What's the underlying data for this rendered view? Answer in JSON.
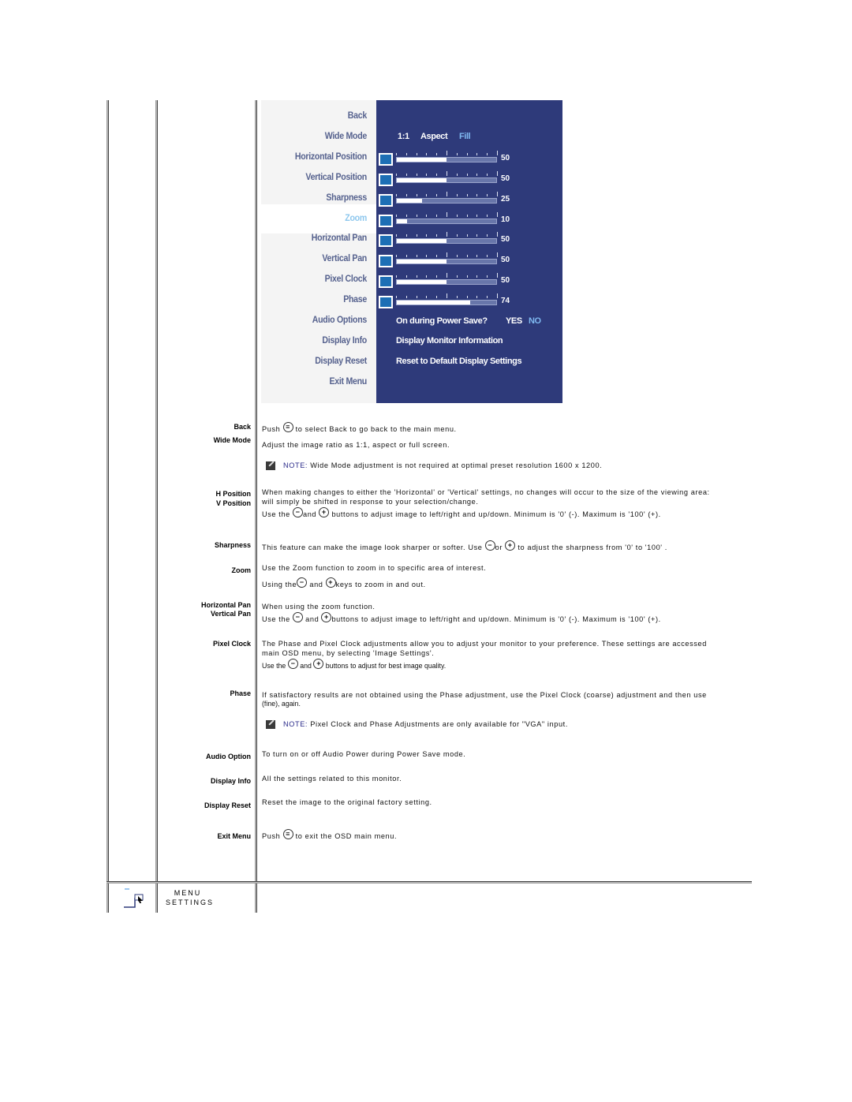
{
  "osd": {
    "menu_items": [
      {
        "label": "Back"
      },
      {
        "label": "Wide Mode"
      },
      {
        "label": "Horizontal Position"
      },
      {
        "label": "Vertical Position"
      },
      {
        "label": "Sharpness"
      },
      {
        "label": "Zoom",
        "active": true
      },
      {
        "label": "Horizontal Pan"
      },
      {
        "label": "Vertical Pan"
      },
      {
        "label": "Pixel Clock"
      },
      {
        "label": "Phase"
      },
      {
        "label": "Audio Options"
      },
      {
        "label": "Display Info"
      },
      {
        "label": "Display Reset"
      },
      {
        "label": "Exit Menu"
      }
    ],
    "wide_mode_options": [
      "1:1",
      "Aspect",
      "Fill"
    ],
    "wide_mode_selected": "Fill",
    "sliders": [
      {
        "name": "Horizontal Position",
        "icon": "horizontal-position-icon",
        "value": 50
      },
      {
        "name": "Vertical Position",
        "icon": "vertical-position-icon",
        "value": 50
      },
      {
        "name": "Sharpness",
        "icon": "sharpness-icon",
        "value": 25
      },
      {
        "name": "Zoom",
        "icon": "zoom-icon",
        "value": 10
      },
      {
        "name": "Horizontal Pan",
        "icon": "horizontal-pan-icon",
        "value": 50
      },
      {
        "name": "Vertical Pan",
        "icon": "vertical-pan-icon",
        "value": 50
      },
      {
        "name": "Pixel Clock",
        "icon": "pixel-clock-icon",
        "value": 50
      },
      {
        "name": "Phase",
        "icon": "phase-icon",
        "value": 74
      }
    ],
    "audio_question": "On during Power Save?",
    "audio_yes": "YES",
    "audio_no": "NO",
    "audio_selected": "NO",
    "display_info_text": "Display Monitor Information",
    "display_reset_text": "Reset to Default Display Settings",
    "colors": {
      "panel": "#2e3a7a",
      "active_item": "#8fc8ee",
      "menu_text": "#56628e"
    }
  },
  "labels": {
    "back": "Back",
    "wide_mode": "Wide Mode",
    "h_position": "H Position",
    "v_position": "V Position",
    "sharpness": "Sharpness",
    "zoom": "Zoom",
    "h_pan": "Horizontal Pan",
    "v_pan": "Vertical  Pan",
    "pixel_clock": "Pixel Clock",
    "phase": "Phase",
    "audio": "Audio Option",
    "display_info": "Display Info",
    "display_reset": "Display Reset",
    "exit": "Exit Menu"
  },
  "descriptions": {
    "back_a": "Push ",
    "back_b": " to select Back to go back to the main menu.",
    "wide": "Adjust the image ratio as 1:1, aspect or full screen.",
    "note_label": "NOTE:",
    "note1": " Wide Mode adjustment is not required at optimal preset resolution 1600 x 1200.",
    "pos_1": "When making changes to either the 'Horizontal' or 'Vertical' settings, no changes will occur to the size of the viewing area:",
    "pos_2": "will simply be shifted in response to your selection/change.",
    "pos_3a": "Use the ",
    "pos_3b": "and ",
    "pos_3c": " buttons to adjust image to left/right and up/down. Minimum is '0' (-). Maximum is '100' (+).",
    "sharp_a": "This feature can make the image look sharper or softer. Use ",
    "sharp_b": "or ",
    "sharp_c": " to adjust the sharpness from '0' to '100' .",
    "zoom_1": "Use the Zoom function to zoom in to specific area of interest.",
    "zoom_2a": "Using the",
    "zoom_2b": " and ",
    "zoom_2c": "keys to zoom in and out.",
    "pan_1": "When using the zoom function.",
    "pan_2a": "Use the ",
    "pan_2b": " and ",
    "pan_2c": "buttons to adjust image to left/right and up/down. Minimum is '0' (-). Maximum is '100' (+).",
    "clock_1": "The Phase and Pixel Clock adjustments allow you to adjust your monitor to your preference. These settings are accessed",
    "clock_2": "main OSD menu, by selecting 'Image Settings'.",
    "clock_3a": "Use the ",
    "clock_3b": " and ",
    "clock_3c": " buttons to adjust for best image quality.",
    "phase_1": "If satisfactory results are not obtained using the Phase adjustment, use the Pixel Clock (coarse) adjustment and then use",
    "phase_2": "(fine), again.",
    "note2": " Pixel Clock and Phase Adjustments are only available for \"VGA\" input.",
    "audio": "To turn on or off Audio Power during Power Save mode.",
    "info": "All the settings related to this monitor.",
    "reset": "Reset the image to the original factory setting.",
    "exit_a": "Push ",
    "exit_b": " to exit the OSD main menu."
  },
  "buttons": {
    "menu": "≡",
    "minus": "−",
    "plus": "+"
  },
  "footer": {
    "menu_line1": "MENU",
    "menu_line2": "SETTINGS",
    "icon": "menu-settings-icon"
  }
}
